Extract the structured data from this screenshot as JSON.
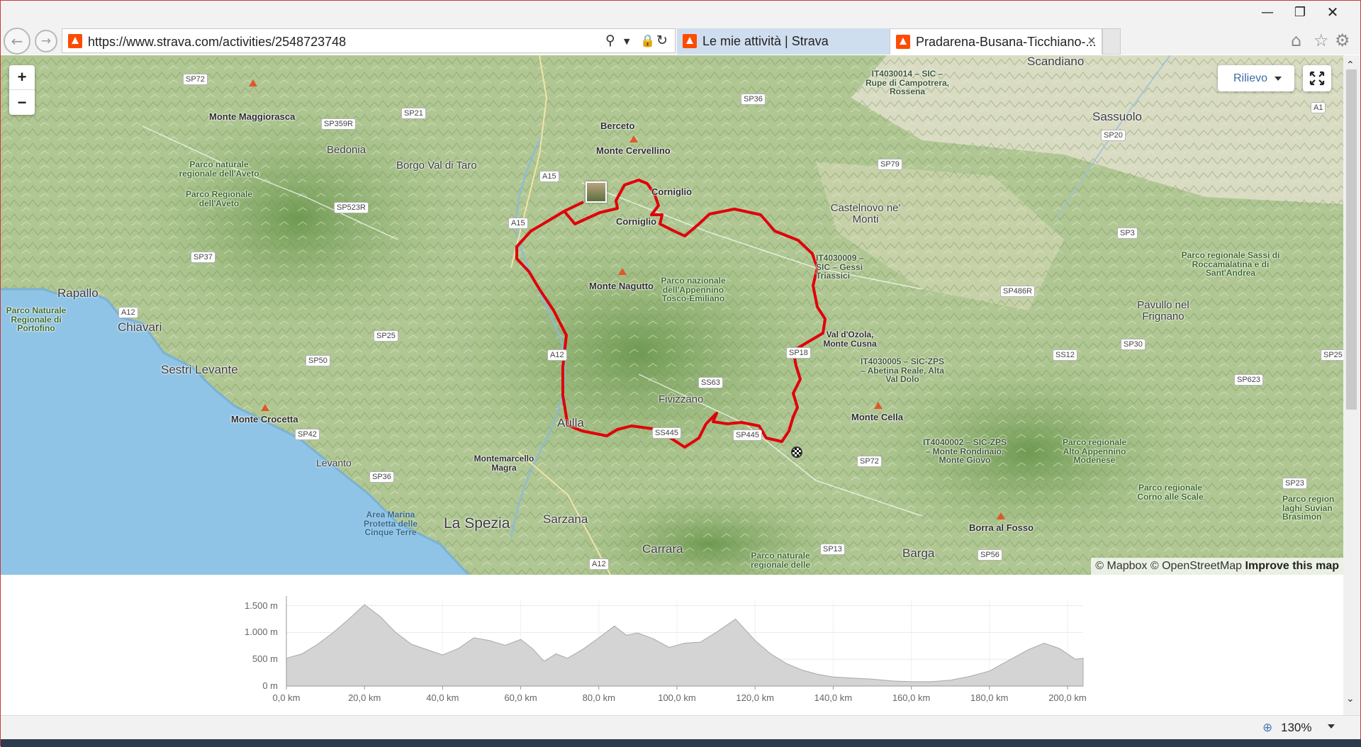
{
  "browser": {
    "url": "https://www.strava.com/activities/2548723748",
    "tabs": [
      {
        "label": "Le mie attività | Strava"
      },
      {
        "label": "Pradarena-Busana-Ticchiano-..."
      }
    ],
    "tab_close": "×",
    "zoom_level": "130%",
    "accent_color": "#fc4c02"
  },
  "map": {
    "zoom_in": "+",
    "zoom_out": "−",
    "layer_selector": "Rilievo",
    "attribution": {
      "mapbox": "© Mapbox",
      "osm": "© OpenStreetMap",
      "improve": "Improve this map"
    },
    "route_color": "#e0000a",
    "towns": [
      {
        "name": "Scandiano"
      },
      {
        "name": "Sassuolo"
      },
      {
        "name": "Berceto"
      },
      {
        "name": "Bedonia"
      },
      {
        "name": "Borgo Val di Taro"
      },
      {
        "name": "Corniglio"
      },
      {
        "name": "Castelnovo ne' Monti"
      },
      {
        "name": "Rapallo"
      },
      {
        "name": "Chiavari"
      },
      {
        "name": "Sestri Levante"
      },
      {
        "name": "Levanto"
      },
      {
        "name": "Aulla"
      },
      {
        "name": "Fivizzano"
      },
      {
        "name": "La Spezia"
      },
      {
        "name": "Sarzana"
      },
      {
        "name": "Carrara"
      },
      {
        "name": "Barga"
      },
      {
        "name": "Pavullo nel Frignano"
      },
      {
        "name": "Montemarcello Magra"
      },
      {
        "name": "Val d'Ozola, Monte Cusna"
      }
    ],
    "peaks": [
      {
        "name": "Monte Maggiorasca"
      },
      {
        "name": "Monte Cervellino"
      },
      {
        "name": "Monte Nagutto"
      },
      {
        "name": "Monte Crocetta"
      },
      {
        "name": "Monte Cella"
      },
      {
        "name": "Borra al Fosso"
      }
    ],
    "parks": [
      {
        "name": "Parco naturale regionale dell'Aveto"
      },
      {
        "name": "Parco Regionale dell'Aveto"
      },
      {
        "name": "Parco nazionale dell'Appennino Tosco-Emiliano"
      },
      {
        "name": "Parco regionale Sassi di Roccamalatina e di Sant'Andrea"
      },
      {
        "name": "Parco regionale Alto Appennino Modenese"
      },
      {
        "name": "Parco regionale Corno alle Scale"
      },
      {
        "name": "Parco region laghi Suvian Brasimon"
      },
      {
        "name": "Parco Naturale Regionale di Portofino"
      },
      {
        "name": "Area Marina Protetta delle Cinque Terre"
      },
      {
        "name": "Parco naturale regionale delle"
      }
    ],
    "natura2000": [
      {
        "name": "IT4030014 – SIC – Rupe di Campotrera, Rossena"
      },
      {
        "name": "IT4030009 – SIC – Gessi Triassici"
      },
      {
        "name": "IT4030005 – SIC-ZPS – Abetina Reale, Alta Val Dolo"
      },
      {
        "name": "IT4040002 – SIC-ZPS – Monte Rondinaio, Monte Giovo"
      }
    ],
    "roads": [
      {
        "label": "SP72"
      },
      {
        "label": "SP359R"
      },
      {
        "label": "SP21"
      },
      {
        "label": "SP36"
      },
      {
        "label": "SP79"
      },
      {
        "label": "SP20"
      },
      {
        "label": "A1"
      },
      {
        "label": "A15"
      },
      {
        "label": "A15"
      },
      {
        "label": "SP523R"
      },
      {
        "label": "SP37"
      },
      {
        "label": "SP3"
      },
      {
        "label": "SP486R"
      },
      {
        "label": "A12"
      },
      {
        "label": "SP25"
      },
      {
        "label": "SP50"
      },
      {
        "label": "A12"
      },
      {
        "label": "SS63"
      },
      {
        "label": "SP18"
      },
      {
        "label": "SS12"
      },
      {
        "label": "SP30"
      },
      {
        "label": "SP25"
      },
      {
        "label": "SP623"
      },
      {
        "label": "SP42"
      },
      {
        "label": "SS445"
      },
      {
        "label": "SP445"
      },
      {
        "label": "SP72"
      },
      {
        "label": "SP36"
      },
      {
        "label": "SP13"
      },
      {
        "label": "SP56"
      },
      {
        "label": "A12"
      },
      {
        "label": "SP23"
      }
    ]
  },
  "elevation": {
    "y_ticks": [
      "1.500 m",
      "1.000 m",
      "500 m",
      "0 m"
    ],
    "x_ticks": [
      "0,0 km",
      "20,0 km",
      "40,0 km",
      "60,0 km",
      "80,0 km",
      "100,0 km",
      "120,0 km",
      "140,0 km",
      "160,0 km",
      "180,0 km",
      "200,0 km"
    ]
  },
  "chart_data": {
    "type": "area",
    "title": "",
    "xlabel": "",
    "ylabel": "",
    "x_unit": "km",
    "y_unit": "m",
    "xlim": [
      0,
      204
    ],
    "ylim": [
      0,
      1600
    ],
    "grid": true,
    "x": [
      0,
      4,
      8,
      12,
      16,
      20,
      24,
      28,
      32,
      36,
      40,
      44,
      48,
      52,
      56,
      60,
      63,
      66,
      69,
      72,
      76,
      80,
      84,
      87,
      90,
      94,
      98,
      102,
      106,
      110,
      115,
      120,
      124,
      128,
      132,
      136,
      140,
      145,
      150,
      155,
      160,
      165,
      170,
      175,
      180,
      185,
      190,
      194,
      198,
      202,
      204
    ],
    "values": [
      520,
      600,
      780,
      1000,
      1250,
      1520,
      1300,
      1000,
      780,
      680,
      580,
      700,
      900,
      850,
      760,
      870,
      700,
      460,
      600,
      520,
      690,
      900,
      1120,
      950,
      990,
      880,
      720,
      800,
      820,
      1000,
      1250,
      850,
      600,
      420,
      300,
      220,
      170,
      150,
      130,
      95,
      80,
      80,
      110,
      180,
      280,
      480,
      680,
      800,
      700,
      500,
      520
    ]
  }
}
